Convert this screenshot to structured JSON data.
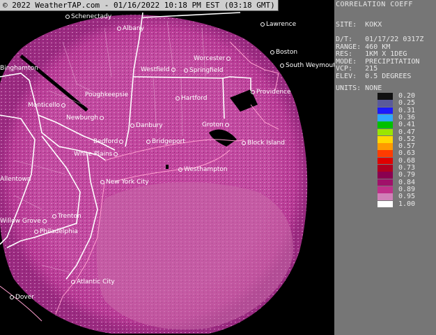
{
  "banner": "© 2022 WeatherTAP.com - 01/16/2022 10:18 PM EST (03:18 GMT)",
  "product": "CORRELATION COEFF",
  "info": {
    "site_label": "SITE:",
    "site": "KOKX",
    "dt_label": "D/T:",
    "dt": "01/17/22 0317Z",
    "range_label": "RANGE:",
    "range": "460 KM",
    "res_label": "RES:",
    "res": "1KM X 1DEG",
    "mode_label": "MODE:",
    "mode": "PRECIPITATION",
    "vcp_label": "VCP:",
    "vcp": "215",
    "elev_label": "ELEV:",
    "elev": "0.5 DEGREES",
    "units_label": "UNITS:",
    "units": "NONE"
  },
  "legend": {
    "levels": [
      "0.20",
      "0.25",
      "0.31",
      "0.36",
      "0.41",
      "0.47",
      "0.52",
      "0.57",
      "0.63",
      "0.68",
      "0.73",
      "0.79",
      "0.84",
      "0.89",
      "0.95",
      "1.00"
    ],
    "colors": [
      "#111111",
      "#5a5a9a",
      "#1a1aff",
      "#2fa8ff",
      "#00c000",
      "#9ae600",
      "#ffd800",
      "#ff9a00",
      "#ff3c00",
      "#e00000",
      "#b00020",
      "#8a0050",
      "#a0106a",
      "#c0308a",
      "#d080b8",
      "#ffffff"
    ]
  },
  "cities": [
    {
      "name": "Schenectady",
      "dot": "left"
    },
    {
      "name": "Albany",
      "dot": "left"
    },
    {
      "name": "Lawrence",
      "dot": "left"
    },
    {
      "name": "Worcester",
      "dot": "right"
    },
    {
      "name": "Boston",
      "dot": "left"
    },
    {
      "name": "Westfield",
      "dot": "right"
    },
    {
      "name": "Springfield",
      "dot": "left"
    },
    {
      "name": "South Weymouth",
      "dot": "left"
    },
    {
      "name": "Binghamton",
      "dot": "none"
    },
    {
      "name": "Poughkeepsie",
      "dot": "none"
    },
    {
      "name": "Providence",
      "dot": "left"
    },
    {
      "name": "Hartford",
      "dot": "left"
    },
    {
      "name": "Monticello",
      "dot": "right"
    },
    {
      "name": "Newburgh",
      "dot": "right"
    },
    {
      "name": "Danbury",
      "dot": "left"
    },
    {
      "name": "Groton",
      "dot": "right"
    },
    {
      "name": "Bedford",
      "dot": "right"
    },
    {
      "name": "Bridgeport",
      "dot": "left"
    },
    {
      "name": "Block Island",
      "dot": "left"
    },
    {
      "name": "White Plains",
      "dot": "right"
    },
    {
      "name": "Westhampton",
      "dot": "left"
    },
    {
      "name": "Allentown",
      "dot": "none"
    },
    {
      "name": "New York City",
      "dot": "left"
    },
    {
      "name": "Trenton",
      "dot": "left"
    },
    {
      "name": "Willow Grove",
      "dot": "right"
    },
    {
      "name": "Philadelphia",
      "dot": "left"
    },
    {
      "name": "Atlantic City",
      "dot": "left"
    },
    {
      "name": "Dover",
      "dot": "left"
    }
  ]
}
